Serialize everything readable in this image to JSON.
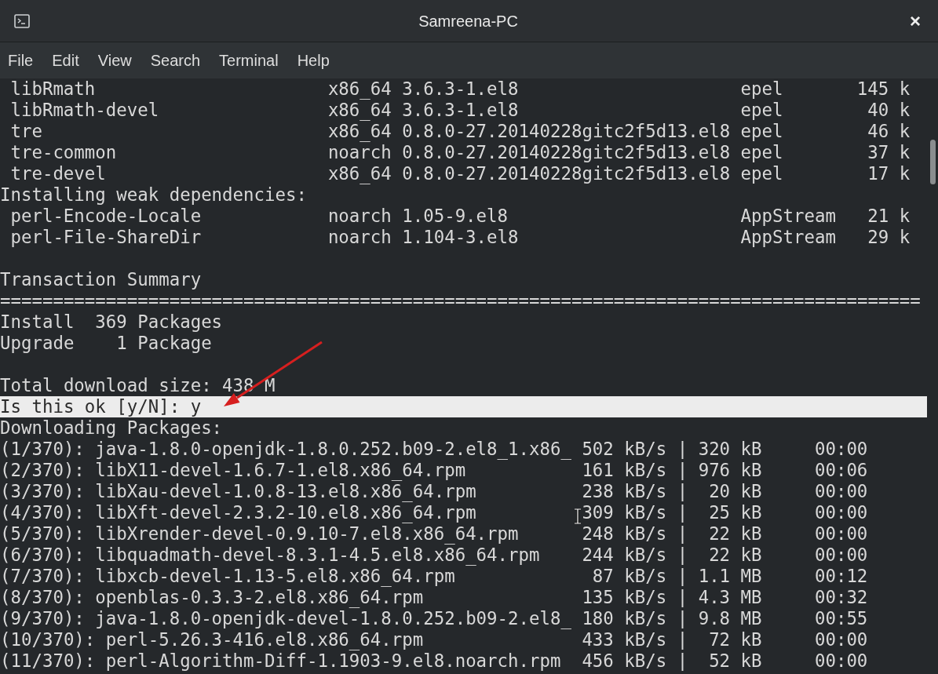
{
  "window": {
    "title": "Samreena-PC",
    "close": "×"
  },
  "menu": [
    {
      "label": "File"
    },
    {
      "label": "Edit"
    },
    {
      "label": "View"
    },
    {
      "label": "Search"
    },
    {
      "label": "Terminal"
    },
    {
      "label": "Help"
    }
  ],
  "terminal": {
    "lines": [
      {
        "kind": "package",
        "name": "libRmath",
        "arch": "x86_64",
        "version": "3.6.3-1.el8",
        "repo": "epel",
        "size": "145 k"
      },
      {
        "kind": "package",
        "name": "libRmath-devel",
        "arch": "x86_64",
        "version": "3.6.3-1.el8",
        "repo": "epel",
        "size": "40 k"
      },
      {
        "kind": "package",
        "name": "tre",
        "arch": "x86_64",
        "version": "0.8.0-27.20140228gitc2f5d13.el8",
        "repo": "epel",
        "size": "46 k"
      },
      {
        "kind": "package",
        "name": "tre-common",
        "arch": "noarch",
        "version": "0.8.0-27.20140228gitc2f5d13.el8",
        "repo": "epel",
        "size": "37 k"
      },
      {
        "kind": "package",
        "name": "tre-devel",
        "arch": "x86_64",
        "version": "0.8.0-27.20140228gitc2f5d13.el8",
        "repo": "epel",
        "size": "17 k"
      },
      {
        "kind": "text",
        "text": "Installing weak dependencies:",
        "highlighted": false
      },
      {
        "kind": "package",
        "name": "perl-Encode-Locale",
        "arch": "noarch",
        "version": "1.05-9.el8",
        "repo": "AppStream",
        "size": "21 k"
      },
      {
        "kind": "package",
        "name": "perl-File-ShareDir",
        "arch": "noarch",
        "version": "1.104-3.el8",
        "repo": "AppStream",
        "size": "29 k"
      },
      {
        "kind": "blank"
      },
      {
        "kind": "text",
        "text": "Transaction Summary",
        "highlighted": false
      },
      {
        "kind": "text",
        "text": "=======================================================================================",
        "highlighted": false
      },
      {
        "kind": "text",
        "text": "Install  369 Packages",
        "highlighted": false
      },
      {
        "kind": "text",
        "text": "Upgrade    1 Package",
        "highlighted": false
      },
      {
        "kind": "blank"
      },
      {
        "kind": "text",
        "text": "Total download size: 438 M",
        "highlighted": false
      },
      {
        "kind": "text",
        "text": "Is this ok [y/N]: y",
        "highlighted": true
      },
      {
        "kind": "text",
        "text": "Downloading Packages:",
        "highlighted": false
      },
      {
        "kind": "download",
        "label": "(1/370): java-1.8.0-openjdk-1.8.0.252.b09-2.el8_1.x86_",
        "rate": "502 kB/s",
        "divider": "|",
        "size": "320 kB",
        "eta": "00:00"
      },
      {
        "kind": "download",
        "label": "(2/370): libX11-devel-1.6.7-1.el8.x86_64.rpm",
        "rate": "161 kB/s",
        "divider": "|",
        "size": "976 kB",
        "eta": "00:06"
      },
      {
        "kind": "download",
        "label": "(3/370): libXau-devel-1.0.8-13.el8.x86_64.rpm",
        "rate": "238 kB/s",
        "divider": "|",
        "size": "20 kB",
        "eta": "00:00"
      },
      {
        "kind": "download",
        "label": "(4/370): libXft-devel-2.3.2-10.el8.x86_64.rpm",
        "rate": "309 kB/s",
        "divider": "|",
        "size": "25 kB",
        "eta": "00:00"
      },
      {
        "kind": "download",
        "label": "(5/370): libXrender-devel-0.9.10-7.el8.x86_64.rpm",
        "rate": "248 kB/s",
        "divider": "|",
        "size": "22 kB",
        "eta": "00:00"
      },
      {
        "kind": "download",
        "label": "(6/370): libquadmath-devel-8.3.1-4.5.el8.x86_64.rpm",
        "rate": "244 kB/s",
        "divider": "|",
        "size": "22 kB",
        "eta": "00:00"
      },
      {
        "kind": "download",
        "label": "(7/370): libxcb-devel-1.13-5.el8.x86_64.rpm",
        "rate": "87 kB/s",
        "divider": "|",
        "size": "1.1 MB",
        "eta": "00:12"
      },
      {
        "kind": "download",
        "label": "(8/370): openblas-0.3.3-2.el8.x86_64.rpm",
        "rate": "135 kB/s",
        "divider": "|",
        "size": "4.3 MB",
        "eta": "00:32"
      },
      {
        "kind": "download",
        "label": "(9/370): java-1.8.0-openjdk-devel-1.8.0.252.b09-2.el8_",
        "rate": "180 kB/s",
        "divider": "|",
        "size": "9.8 MB",
        "eta": "00:55"
      },
      {
        "kind": "download",
        "label": "(10/370): perl-5.26.3-416.el8.x86_64.rpm",
        "rate": "433 kB/s",
        "divider": "|",
        "size": "72 kB",
        "eta": "00:00"
      },
      {
        "kind": "download",
        "label": "(11/370): perl-Algorithm-Diff-1.1903-9.el8.noarch.rpm",
        "rate": "456 kB/s",
        "divider": "|",
        "size": "52 kB",
        "eta": "00:00"
      }
    ]
  }
}
